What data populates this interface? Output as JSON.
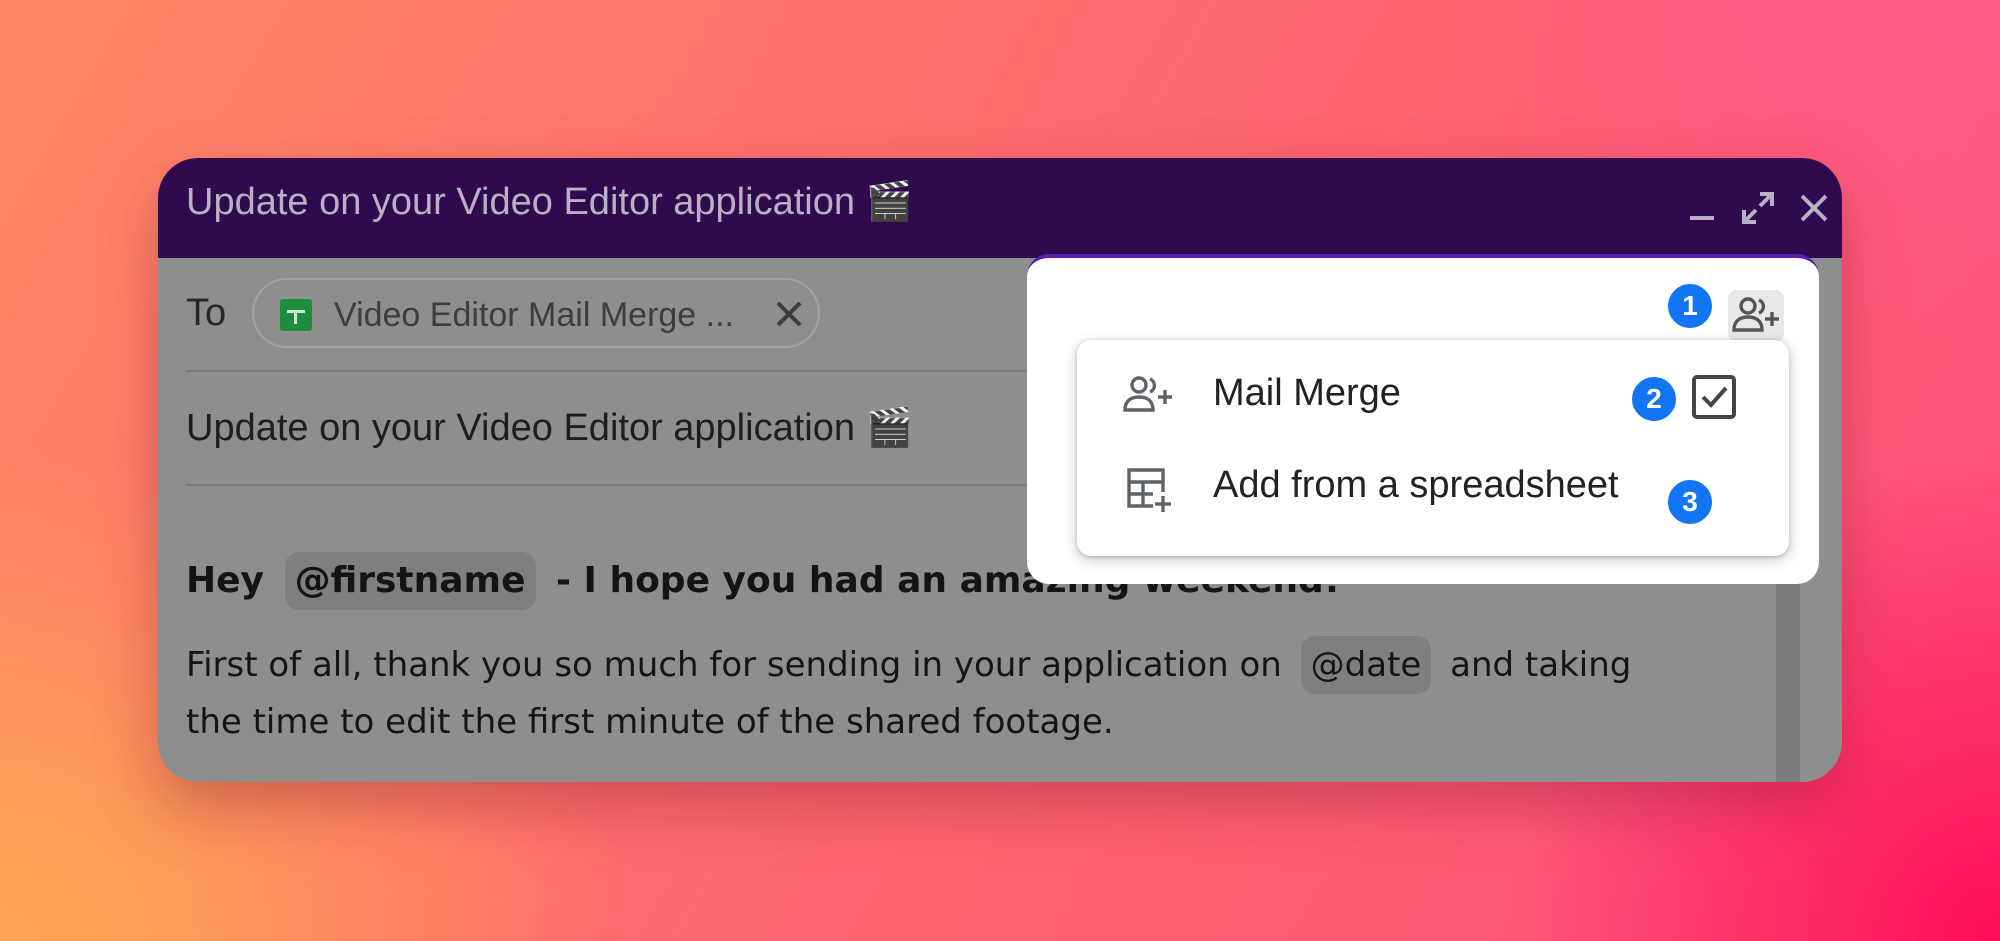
{
  "window": {
    "title": "Update on your Video Editor application",
    "title_emoji": "🎬",
    "controls": [
      "minimize-icon",
      "expand-icon",
      "close-icon"
    ]
  },
  "recipients": {
    "label": "To",
    "chip_text": "Video Editor Mail Merge ...",
    "chip_icon": "google-sheets-icon"
  },
  "subject": {
    "text": "Update on your Video Editor application",
    "emoji": "🎬"
  },
  "message": {
    "greeting_start": "Hey",
    "firstname_tag": "@firstname",
    "greeting_end": "- I hope you had an amazing weekend!",
    "para_start": "First of all, thank you so much for sending in your application on",
    "date_tag": "@date",
    "para_end": "and taking the time to edit the first minute of the shared footage."
  },
  "popup": {
    "menu": [
      {
        "label": "Mail Merge",
        "icon": "group-add-icon",
        "checked": true
      },
      {
        "label": "Add from a spreadsheet",
        "icon": "spreadsheet-add-icon"
      }
    ]
  },
  "annotations": {
    "badge_1": "1",
    "badge_2": "2",
    "badge_3": "3"
  },
  "colors": {
    "titlebar": "#300a4f",
    "badge": "#1275f5",
    "sheets_green": "#1e8e3e",
    "popup_accent": "#5b1eb0"
  }
}
